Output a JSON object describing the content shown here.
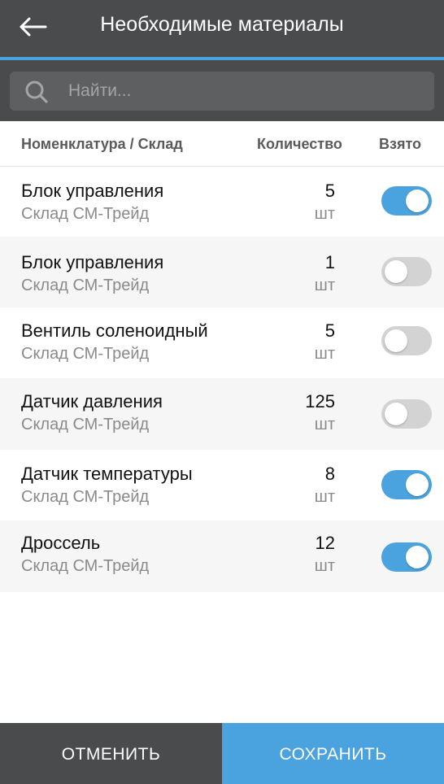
{
  "header": {
    "title": "Необходимые материалы",
    "back_icon": "arrow-left-icon"
  },
  "search": {
    "placeholder": "Найти...",
    "value": "",
    "icon": "search-icon"
  },
  "columns": {
    "name": "Номенклатура / Склад",
    "quantity": "Количество",
    "taken": "Взято"
  },
  "items": [
    {
      "name": "Блок управления",
      "store": "Склад СМ-Трейд",
      "qty": "5",
      "unit": "шт",
      "taken": true
    },
    {
      "name": "Блок управления",
      "store": "Склад СМ-Трейд",
      "qty": "1",
      "unit": "шт",
      "taken": false
    },
    {
      "name": "Вентиль соленоидный",
      "store": "Склад СМ-Трейд",
      "qty": "5",
      "unit": "шт",
      "taken": false
    },
    {
      "name": "Датчик давления",
      "store": "Склад СМ-Трейд",
      "qty": "125",
      "unit": "шт",
      "taken": false
    },
    {
      "name": "Датчик температуры",
      "store": "Склад СМ-Трейд",
      "qty": "8",
      "unit": "шт",
      "taken": true
    },
    {
      "name": "Дроссель",
      "store": "Склад СМ-Трейд",
      "qty": "12",
      "unit": "шт",
      "taken": true
    }
  ],
  "footer": {
    "cancel_label": "ОТМЕНИТЬ",
    "save_label": "СОХРАНИТЬ"
  },
  "colors": {
    "header_bg": "#4a4b4d",
    "accent": "#4aa3df",
    "toggle_off": "#d3d3d3"
  }
}
